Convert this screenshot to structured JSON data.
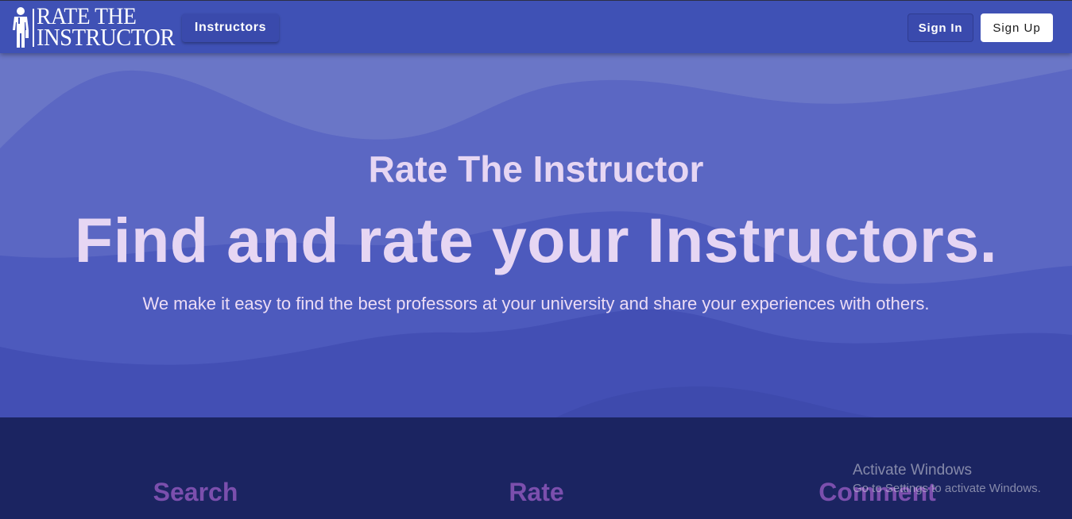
{
  "navbar": {
    "logo": {
      "line1": "RATE THE",
      "line2": "INSTRUCTOR",
      "icon": "instructor-figure-icon"
    },
    "instructors_label": "Instructors",
    "signin_label": "Sign In",
    "signup_label": "Sign Up"
  },
  "hero": {
    "subtitle": "Rate The Instructor",
    "title": "Find and rate your Instructors.",
    "description": "We make it easy to find the best professors at your university and share your experiences with others."
  },
  "features": {
    "items": [
      {
        "label": "Search"
      },
      {
        "label": "Rate"
      },
      {
        "label": "Comment"
      }
    ]
  },
  "watermark": {
    "title": "Activate Windows",
    "subtitle": "Go to Settings to activate Windows."
  },
  "colors": {
    "navbar": "#3f51b5",
    "hero_text": "#e6d6f3",
    "features_bg": "#1b2461",
    "feature_label": "#7b4fad"
  }
}
